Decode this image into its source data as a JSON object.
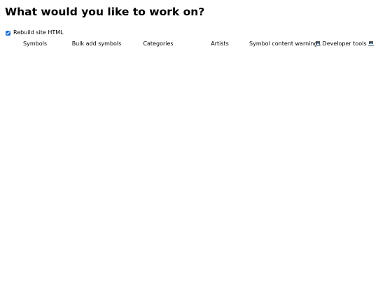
{
  "page": {
    "title": "What would you like to work on?"
  },
  "rebuild": {
    "label": "Rebuild site HTML",
    "checked": true
  },
  "nav": {
    "items": [
      {
        "label": "Symbols"
      },
      {
        "label": "Bulk add symbols"
      },
      {
        "label": "Categories"
      },
      {
        "label": "Artists"
      },
      {
        "label": "Symbol content warnings"
      },
      {
        "label": "Developer tools",
        "icon": "laptop-icon"
      }
    ]
  },
  "colors": {
    "checkbox_accent": "#1a6fd6",
    "text": "#000000",
    "background": "#ffffff"
  }
}
